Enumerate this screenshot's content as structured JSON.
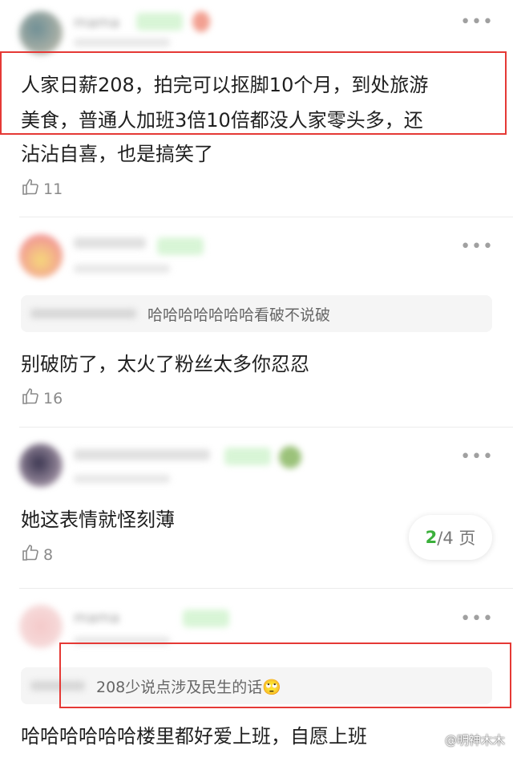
{
  "comments": [
    {
      "name": "mama",
      "tag": "",
      "meta": "",
      "text_lines": [
        "人家日薪208，拍完可以抠脚10个月，到处旅游",
        "美食，普通人加班3倍10倍都没人家零头多，还",
        "沾沾自喜，也是搞笑了"
      ],
      "likes": "11"
    },
    {
      "name": "",
      "tag": "",
      "meta": "",
      "quote_name": "",
      "quote_text": "哈哈哈哈哈哈哈看破不说破",
      "text": "别破防了，太火了粉丝太多你忍忍",
      "likes": "16"
    },
    {
      "name": "",
      "tag": "",
      "meta": "",
      "text": "她这表情就怪刻薄",
      "likes": "8"
    },
    {
      "name": "mama",
      "tag": "",
      "meta": "",
      "quote_name": "",
      "quote_text": "208少说点涉及民生的话🙄",
      "text": "哈哈哈哈哈哈楼里都好爱上班，自愿上班"
    }
  ],
  "pager": {
    "current": "2",
    "rest": "/4 页"
  },
  "watermark": "@明神木木",
  "colors": {
    "accent_green": "#3bb03b",
    "highlight_red": "#e53935"
  }
}
